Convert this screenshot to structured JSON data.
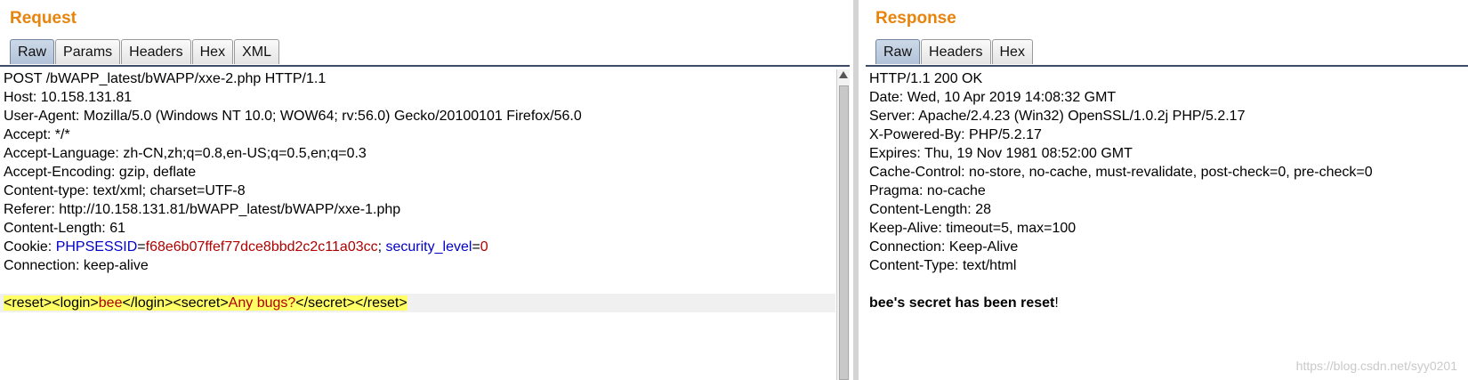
{
  "request": {
    "title": "Request",
    "tabs": [
      {
        "label": "Raw"
      },
      {
        "label": "Params"
      },
      {
        "label": "Headers"
      },
      {
        "label": "Hex"
      },
      {
        "label": "XML"
      }
    ],
    "lines": [
      "POST /bWAPP_latest/bWAPP/xxe-2.php HTTP/1.1",
      "Host: 10.158.131.81",
      "User-Agent: Mozilla/5.0 (Windows NT 10.0; WOW64; rv:56.0) Gecko/20100101 Firefox/56.0",
      "Accept: */*",
      "Accept-Language: zh-CN,zh;q=0.8,en-US;q=0.5,en;q=0.3",
      "Accept-Encoding: gzip, deflate",
      "Content-type: text/xml; charset=UTF-8",
      "Referer: http://10.158.131.81/bWAPP_latest/bWAPP/xxe-1.php",
      "Content-Length: 61"
    ],
    "cookie": {
      "prefix": "Cookie: ",
      "name1": "PHPSESSID",
      "eq1": "=",
      "value1": "f68e6b07ffef77dce8bbd2c2c11a03cc",
      "sep": "; ",
      "name2": "security_level",
      "eq2": "=",
      "value2": "0"
    },
    "connection": "Connection: keep-alive",
    "body": {
      "reset_open": "<reset>",
      "login_open": "<login>",
      "login_value": "bee",
      "login_close": "</login>",
      "secret_open": "<secret>",
      "secret_value": "Any bugs?",
      "secret_close": "</secret>",
      "reset_close": "</reset>"
    }
  },
  "response": {
    "title": "Response",
    "tabs": [
      {
        "label": "Raw"
      },
      {
        "label": "Headers"
      },
      {
        "label": "Hex"
      }
    ],
    "lines": [
      "HTTP/1.1 200 OK",
      "Date: Wed, 10 Apr 2019 14:08:32 GMT",
      "Server: Apache/2.4.23 (Win32) OpenSSL/1.0.2j PHP/5.2.17",
      "X-Powered-By: PHP/5.2.17",
      "Expires: Thu, 19 Nov 1981 08:52:00 GMT",
      "Cache-Control: no-store, no-cache, must-revalidate, post-check=0, pre-check=0",
      "Pragma: no-cache",
      "Content-Length: 28",
      "Keep-Alive: timeout=5, max=100",
      "Connection: Keep-Alive",
      "Content-Type: text/html"
    ],
    "body_bold": "bee's secret has been reset",
    "body_tail": "!"
  },
  "watermark": "https://blog.csdn.net/syy0201",
  "colors": {
    "title": "#e8830b",
    "param_name": "#0000c8",
    "param_value": "#b00000",
    "highlight": "#ffff66"
  }
}
